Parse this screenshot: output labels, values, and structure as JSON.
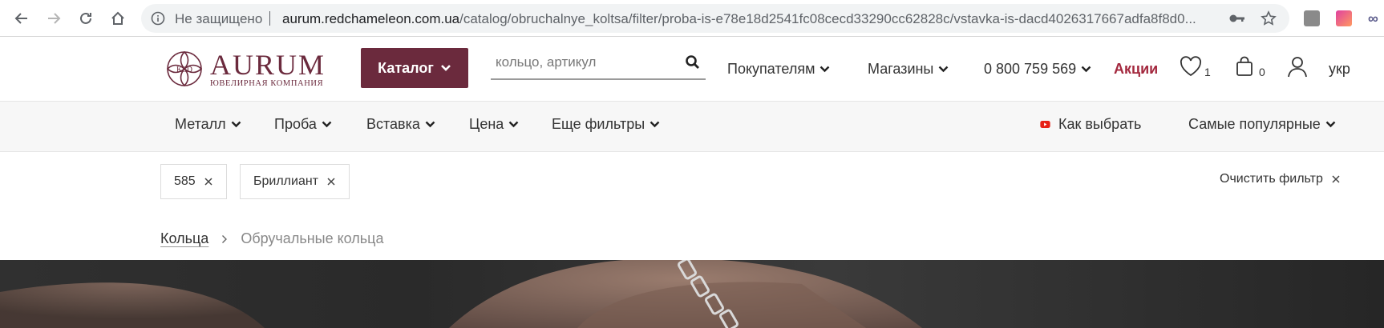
{
  "browser": {
    "insecure_label": "Не защищено",
    "url_host": "aurum.redchameleon.com.ua",
    "url_path": "/catalog/obruchalnye_koltsa/filter/proba-is-e78e18d2541fc08cecd33290cc62828c/vstavka-is-dacd4026317667adfa8f8d0..."
  },
  "header": {
    "logo_brand": "AURUM",
    "logo_tagline": "ювелирная компания",
    "logo_monogram": "KSD",
    "catalog_label": "Каталог",
    "search_placeholder": "кольцо, артикул",
    "nav": {
      "customers": "Покупателям",
      "stores": "Магазины",
      "phone": "0 800 759 569",
      "promo": "Акции"
    },
    "wishlist_count": "1",
    "cart_count": "0",
    "language": "укр",
    "accent_color": "#6b2a3d",
    "promo_color": "#a3283e"
  },
  "filters": {
    "metal": "Металл",
    "probe": "Проба",
    "insert": "Вставка",
    "price": "Цена",
    "more": "Еще фильтры",
    "how_to_choose": "Как выбрать",
    "sort": "Самые популярные"
  },
  "active_filters": {
    "chips": [
      "585",
      "Бриллиант"
    ],
    "clear_label": "Очистить фильтр"
  },
  "breadcrumbs": [
    "Кольца",
    "Обручальные кольца"
  ]
}
